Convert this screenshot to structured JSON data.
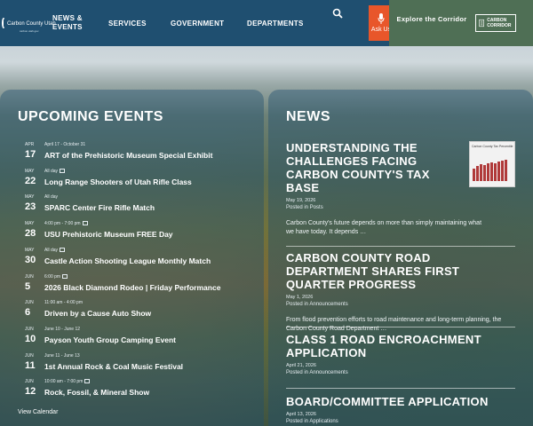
{
  "header": {
    "logo_text": "Carbon County Utah",
    "logo_sub": "carbon.utah.gov",
    "nav": [
      {
        "label": "News & Events"
      },
      {
        "label": "Services"
      },
      {
        "label": "Government"
      },
      {
        "label": "Departments"
      }
    ],
    "ask_label": "Ask Us",
    "explore_label": "Explore the Corridor",
    "corridor_logo_text": "CARBON CORRIDOR"
  },
  "events": {
    "title": "Upcoming Events",
    "items": [
      {
        "month": "APR",
        "day": "17",
        "time": "April 17 - October 31",
        "cal": false,
        "title": "ART of the Prehistoric Museum Special Exhibit"
      },
      {
        "month": "MAY",
        "day": "22",
        "time": "All day",
        "cal": true,
        "title": "Long Range Shooters of Utah Rifle Class"
      },
      {
        "month": "MAY",
        "day": "23",
        "time": "All day",
        "cal": false,
        "title": "SPARC Center Fire Rifle Match"
      },
      {
        "month": "MAY",
        "day": "28",
        "time": "4:00 pm - 7:00 pm",
        "cal": true,
        "title": "USU Prehistoric Museum FREE Day"
      },
      {
        "month": "MAY",
        "day": "30",
        "time": "All day",
        "cal": true,
        "title": "Castle Action Shooting League Monthly Match"
      },
      {
        "month": "JUN",
        "day": "5",
        "time": "6:00 pm",
        "cal": true,
        "title": "2026 Black Diamond Rodeo | Friday Performance"
      },
      {
        "month": "JUN",
        "day": "6",
        "time": "11:00 am - 4:00 pm",
        "cal": false,
        "title": "Driven by a Cause Auto Show"
      },
      {
        "month": "JUN",
        "day": "10",
        "time": "June 10 - June 12",
        "cal": false,
        "title": "Payson Youth Group Camping Event"
      },
      {
        "month": "JUN",
        "day": "11",
        "time": "June 11 - June 13",
        "cal": false,
        "title": "1st Annual Rock & Coal Music Festival"
      },
      {
        "month": "JUN",
        "day": "12",
        "time": "10:00 am - 7:00 pm",
        "cal": true,
        "title": "Rock, Fossil, & Mineral Show"
      }
    ],
    "view_calendar": "View Calendar"
  },
  "news": {
    "title": "News",
    "thumb_title": "Carbon County Tax Percentile",
    "items": [
      {
        "title": "Understanding the Challenges Facing Carbon County's Tax Base",
        "date": "May 19, 2026",
        "meta": "Posted in Posts",
        "excerpt": "Carbon County's future depends on more than simply maintaining what we have today. It depends …"
      },
      {
        "title": "Carbon County Road Department Shares First Quarter Progress",
        "date": "May 1, 2026",
        "meta": "Posted in Announcements",
        "excerpt": "From flood prevention efforts to road maintenance and long-term planning, the Carbon County Road Department …"
      },
      {
        "title": "Class 1 Road Encroachment Application",
        "date": "April 21, 2026",
        "meta": "Posted in Announcements",
        "excerpt": ""
      },
      {
        "title": "Board/Committee Application",
        "date": "April 13, 2026",
        "meta": "Posted in Applications",
        "excerpt": ""
      }
    ]
  }
}
